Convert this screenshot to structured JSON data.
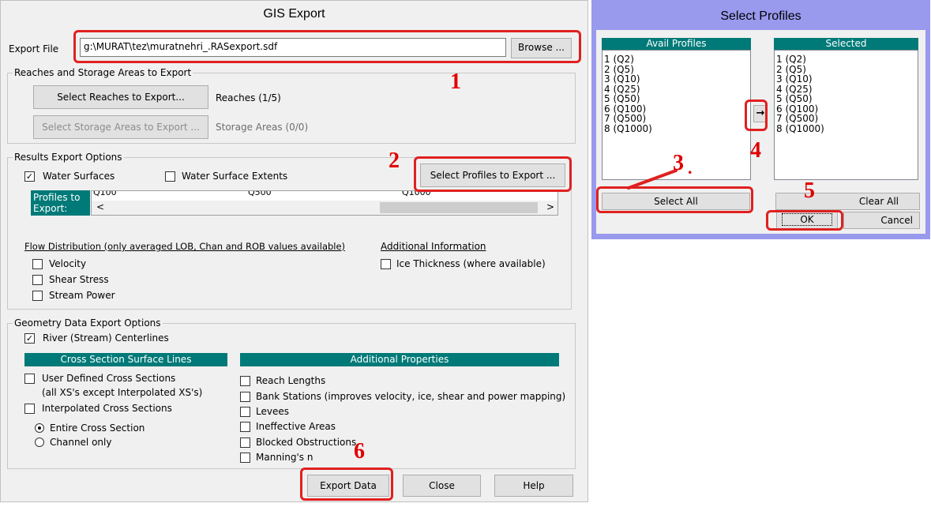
{
  "gis": {
    "title": "GIS Export",
    "export_file_label": "Export File",
    "export_file_value": "g:\\MURAT\\tez\\muratnehri_.RASexport.sdf",
    "browse_label": "Browse ...",
    "reaches_group": "Reaches and Storage Areas to Export",
    "select_reaches_label": "Select Reaches to Export...",
    "reaches_count": "Reaches (1/5)",
    "select_storage_label": "Select Storage Areas to Export ...",
    "storage_count": "Storage Areas (0/0)",
    "results_group": "Results Export Options",
    "water_surfaces": {
      "label": "Water Surfaces",
      "checked": true
    },
    "water_surface_extents": {
      "label": "Water Surface Extents",
      "checked": false
    },
    "select_profiles_label": "Select Profiles to Export ...",
    "profiles_to_export_label": "Profiles to Export:",
    "profiles_strip": [
      "Q100",
      "Q500",
      "Q1000"
    ],
    "scroll_left": "<",
    "scroll_right": ">",
    "flow_dist_label": "Flow Distribution (only averaged LOB, Chan and ROB values available)",
    "velocity": "Velocity",
    "shear_stress": "Shear Stress",
    "stream_power": "Stream Power",
    "additional_info_label": "Additional Information",
    "ice_thickness": "Ice Thickness (where available)",
    "geometry_group": "Geometry Data Export Options",
    "river_centerlines": {
      "label": "River (Stream) Centerlines",
      "checked": true
    },
    "xs_header": "Cross Section Surface Lines",
    "user_defined_xs": "User Defined Cross Sections",
    "user_defined_xs_sub": "(all XS's except Interpolated XS's)",
    "interpolated_xs": "Interpolated Cross Sections",
    "entire_xs": "Entire Cross Section",
    "channel_only": "Channel only",
    "addl_props_header": "Additional Properties",
    "reach_lengths": "Reach Lengths",
    "bank_stations": "Bank Stations (improves velocity, ice, shear and power mapping)",
    "levees": "Levees",
    "ineffective_areas": "Ineffective Areas",
    "blocked_obstructions": "Blocked Obstructions",
    "mannings_n": "Manning's n",
    "export_data_label": "Export Data",
    "close_label": "Close",
    "help_label": "Help"
  },
  "profiles_dialog": {
    "title": "Select Profiles",
    "avail_header": "Avail Profiles",
    "selected_header": "Selected",
    "avail": [
      "1 (Q2)",
      "2 (Q5)",
      "3 (Q10)",
      "4 (Q25)",
      "5 (Q50)",
      "6 (Q100)",
      "7 (Q500)",
      "8 (Q1000)"
    ],
    "selected": [
      "1 (Q2)",
      "2 (Q5)",
      "3 (Q10)",
      "4 (Q25)",
      "5 (Q50)",
      "6 (Q100)",
      "7 (Q500)",
      "8 (Q1000)"
    ],
    "arrow_label": "→",
    "select_all_label": "Select All",
    "clear_all_label": "Clear All",
    "ok_label": "OK",
    "cancel_label": "Cancel"
  },
  "annotations": [
    "1",
    "2",
    "3",
    "4",
    "5",
    "6"
  ],
  "colors": {
    "accent_teal": "#007a78",
    "dialog_frame": "#9999ee",
    "annotation_red": "#e02020"
  }
}
